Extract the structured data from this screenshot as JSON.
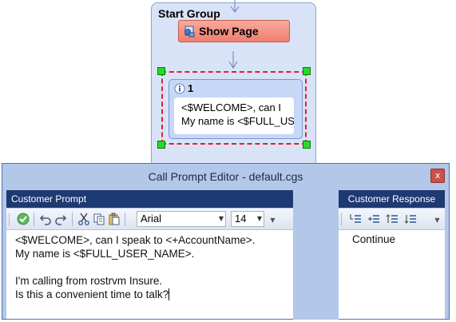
{
  "flow": {
    "group_title": "Start Group",
    "show_page_label": "Show Page",
    "prompt_node": {
      "number": "1",
      "preview_line1": "<$WELCOME>, can I",
      "preview_line2": "My name is <$FULL_USER"
    }
  },
  "editor": {
    "title": "Call Prompt Editor - default.cgs",
    "close_glyph": "x",
    "customer_prompt_header": "Customer Prompt",
    "customer_response_header": "Customer Response",
    "toolbar": {
      "font": "Arial",
      "size": "14",
      "icons": [
        "check-icon",
        "undo-icon",
        "redo-icon",
        "cut-icon",
        "copy-icon",
        "paste-icon"
      ]
    },
    "response_toolbar_icons": [
      "insert-before-icon",
      "insert-after-icon",
      "move-up-icon",
      "move-down-icon"
    ],
    "prompt_lines": [
      "<$WELCOME>, can I speak to <+AccountName>.",
      "My name is <$FULL_USER_NAME>.",
      "",
      "I'm calling from rostrvm Insure.",
      "Is this a convenient time to talk?"
    ],
    "responses": [
      "Continue"
    ]
  },
  "colors": {
    "header_bg": "#1e3a72",
    "window_bg": "#b3c7e8",
    "selection_dash": "#e0202a",
    "handle": "#22dd22",
    "show_page_bg": "#ef7f6f"
  }
}
